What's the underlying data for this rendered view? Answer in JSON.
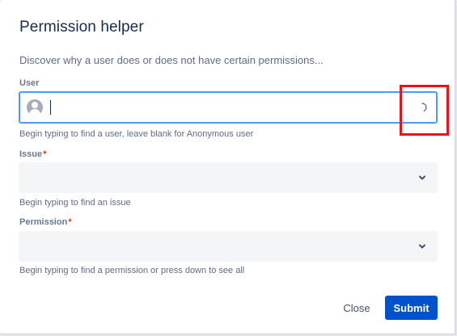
{
  "dialog": {
    "title": "Permission helper",
    "intro": "Discover why a user does or does not have certain permissions..."
  },
  "user_field": {
    "label": "User",
    "value": "",
    "help": "Begin typing to find a user, leave blank for Anonymous user",
    "status": "loading"
  },
  "issue_field": {
    "label": "Issue",
    "required_marker": "*",
    "value": "",
    "help": "Begin typing to find an issue"
  },
  "permission_field": {
    "label": "Permission",
    "required_marker": "*",
    "value": "",
    "help": "Begin typing to find a permission or press down to see all"
  },
  "footer": {
    "close_label": "Close",
    "submit_label": "Submit"
  },
  "icons": {
    "user": "user-avatar-icon",
    "spinner": "loading-spinner-icon",
    "chevron": "chevron-down-icon"
  },
  "colors": {
    "primary": "#0052cc",
    "focus_border": "#4c9aff",
    "required": "#de350b",
    "highlight": "#e8141a"
  }
}
